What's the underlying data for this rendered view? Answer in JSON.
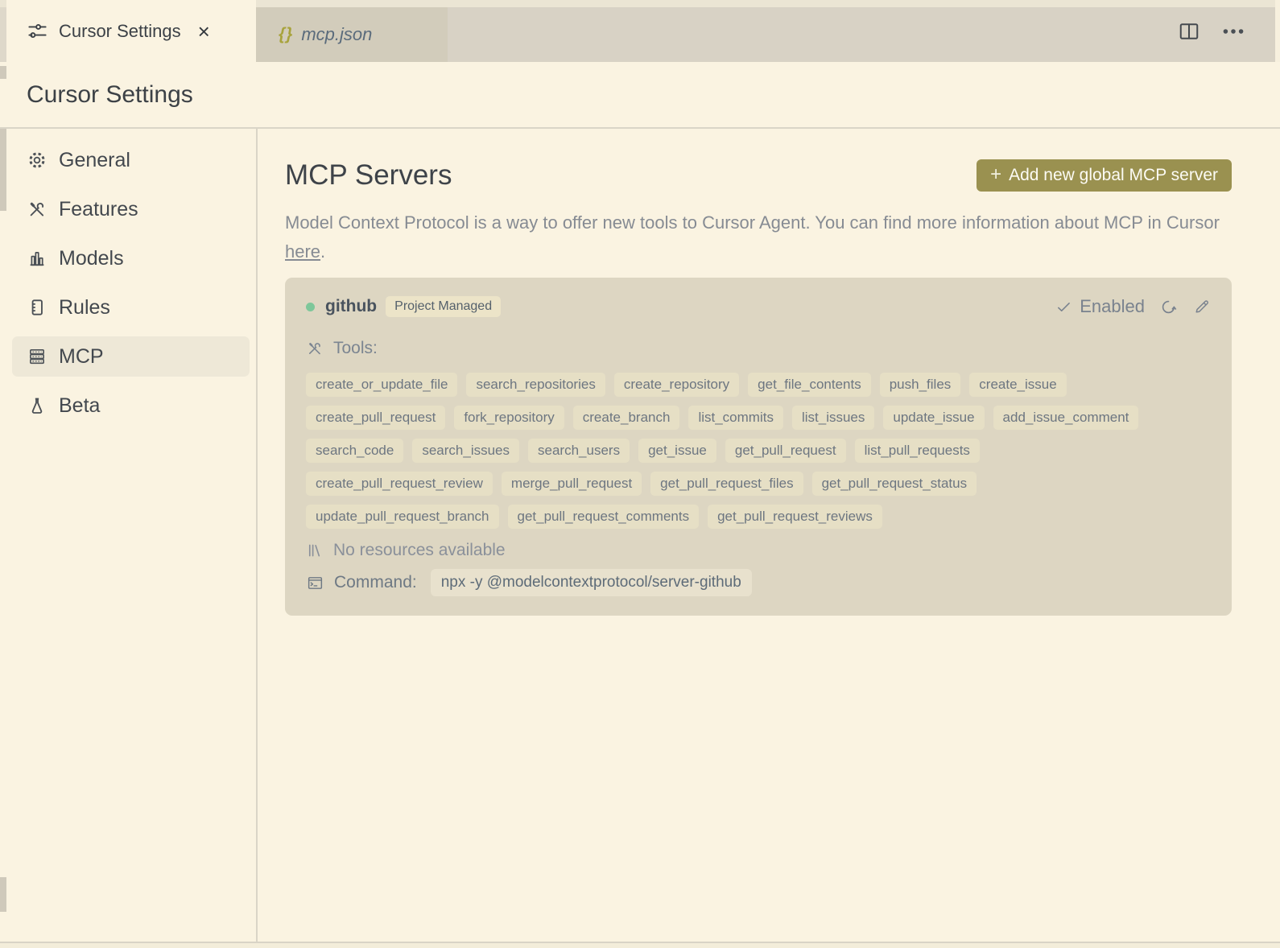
{
  "colors": {
    "accent_button": "#9a9150",
    "status_dot_green": "#7ec79a",
    "file_icon_olive": "#a8a33c",
    "background_cream": "#faf3e1",
    "card_tan": "#ddd6c2"
  },
  "icons": {
    "close": "×",
    "plus": "+",
    "braces": "{}"
  },
  "tab_bar": {
    "tabs": [
      {
        "label": "Cursor Settings",
        "active": true
      },
      {
        "label": "mcp.json",
        "active": false
      }
    ]
  },
  "page_header": {
    "title": "Cursor Settings"
  },
  "sidebar": {
    "items": [
      {
        "label": "General"
      },
      {
        "label": "Features"
      },
      {
        "label": "Models"
      },
      {
        "label": "Rules"
      },
      {
        "label": "MCP",
        "selected": true
      },
      {
        "label": "Beta"
      }
    ]
  },
  "main": {
    "title": "MCP Servers",
    "add_button": {
      "label": "Add new global MCP server"
    },
    "description": {
      "text": "Model Context Protocol is a way to offer new tools to Cursor Agent. You can find more information about MCP in Cursor ",
      "link_text": "here",
      "suffix": "."
    },
    "server": {
      "name": "github",
      "badge": "Project Managed",
      "status": "Enabled",
      "tools_label": "Tools:",
      "tool_rows": [
        [
          "create_or_update_file",
          "search_repositories",
          "create_repository",
          "get_file_contents",
          "push_files",
          "create_issue"
        ],
        [
          "create_pull_request",
          "fork_repository",
          "create_branch",
          "list_commits",
          "list_issues",
          "update_issue",
          "add_issue_comment"
        ],
        [
          "search_code",
          "search_issues",
          "search_users",
          "get_issue",
          "get_pull_request",
          "list_pull_requests"
        ],
        [
          "create_pull_request_review",
          "merge_pull_request",
          "get_pull_request_files",
          "get_pull_request_status"
        ],
        [
          "update_pull_request_branch",
          "get_pull_request_comments",
          "get_pull_request_reviews"
        ]
      ],
      "resources_text": "No resources available",
      "command_label": "Command:",
      "command": "npx -y @modelcontextprotocol/server-github"
    }
  }
}
